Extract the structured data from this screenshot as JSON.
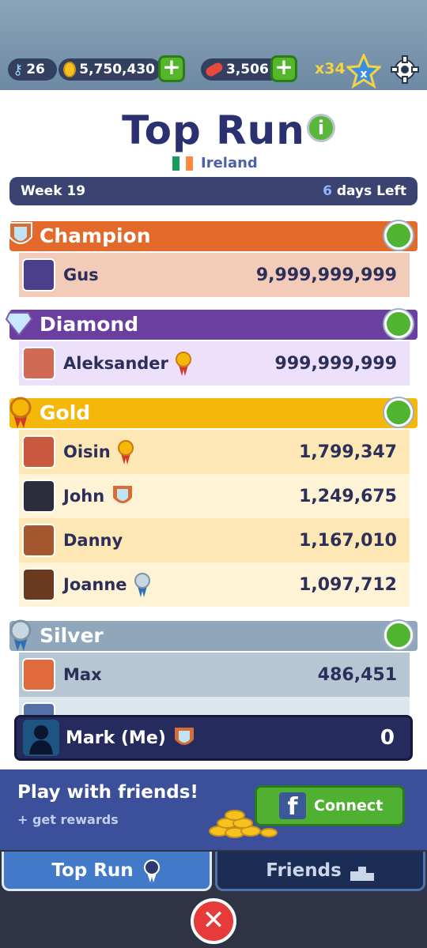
{
  "top": {
    "keys": "26",
    "coins": "5,750,430",
    "boards": "3,506",
    "multiplier": "x34"
  },
  "header": {
    "title": "Top Run",
    "country": "Ireland",
    "week": "Week 19",
    "days_num": "6",
    "days_text": " days Left"
  },
  "leagues": {
    "champion": {
      "label": "Champion",
      "color": "#e46a2c"
    },
    "diamond": {
      "label": "Diamond",
      "color": "#6a3fa0"
    },
    "gold": {
      "label": "Gold",
      "color": "#f5b80a"
    },
    "silver": {
      "label": "Silver",
      "color": "#90a7bb"
    }
  },
  "rows": [
    {
      "name": "Gus",
      "score": "9,999,999,999"
    },
    {
      "name": "Aleksander",
      "score": "999,999,999"
    },
    {
      "name": "Oisin",
      "score": "1,799,347"
    },
    {
      "name": "John",
      "score": "1,249,675"
    },
    {
      "name": "Danny",
      "score": "1,167,010"
    },
    {
      "name": "Joanne",
      "score": "1,097,712"
    },
    {
      "name": "Max",
      "score": "486,451"
    }
  ],
  "me": {
    "name": "Mark (Me)",
    "score": "0"
  },
  "promo": {
    "heading": "Play with friends!",
    "sub": "+ get rewards",
    "connect": "Connect"
  },
  "tabs": {
    "top_run": "Top Run",
    "friends": "Friends"
  }
}
